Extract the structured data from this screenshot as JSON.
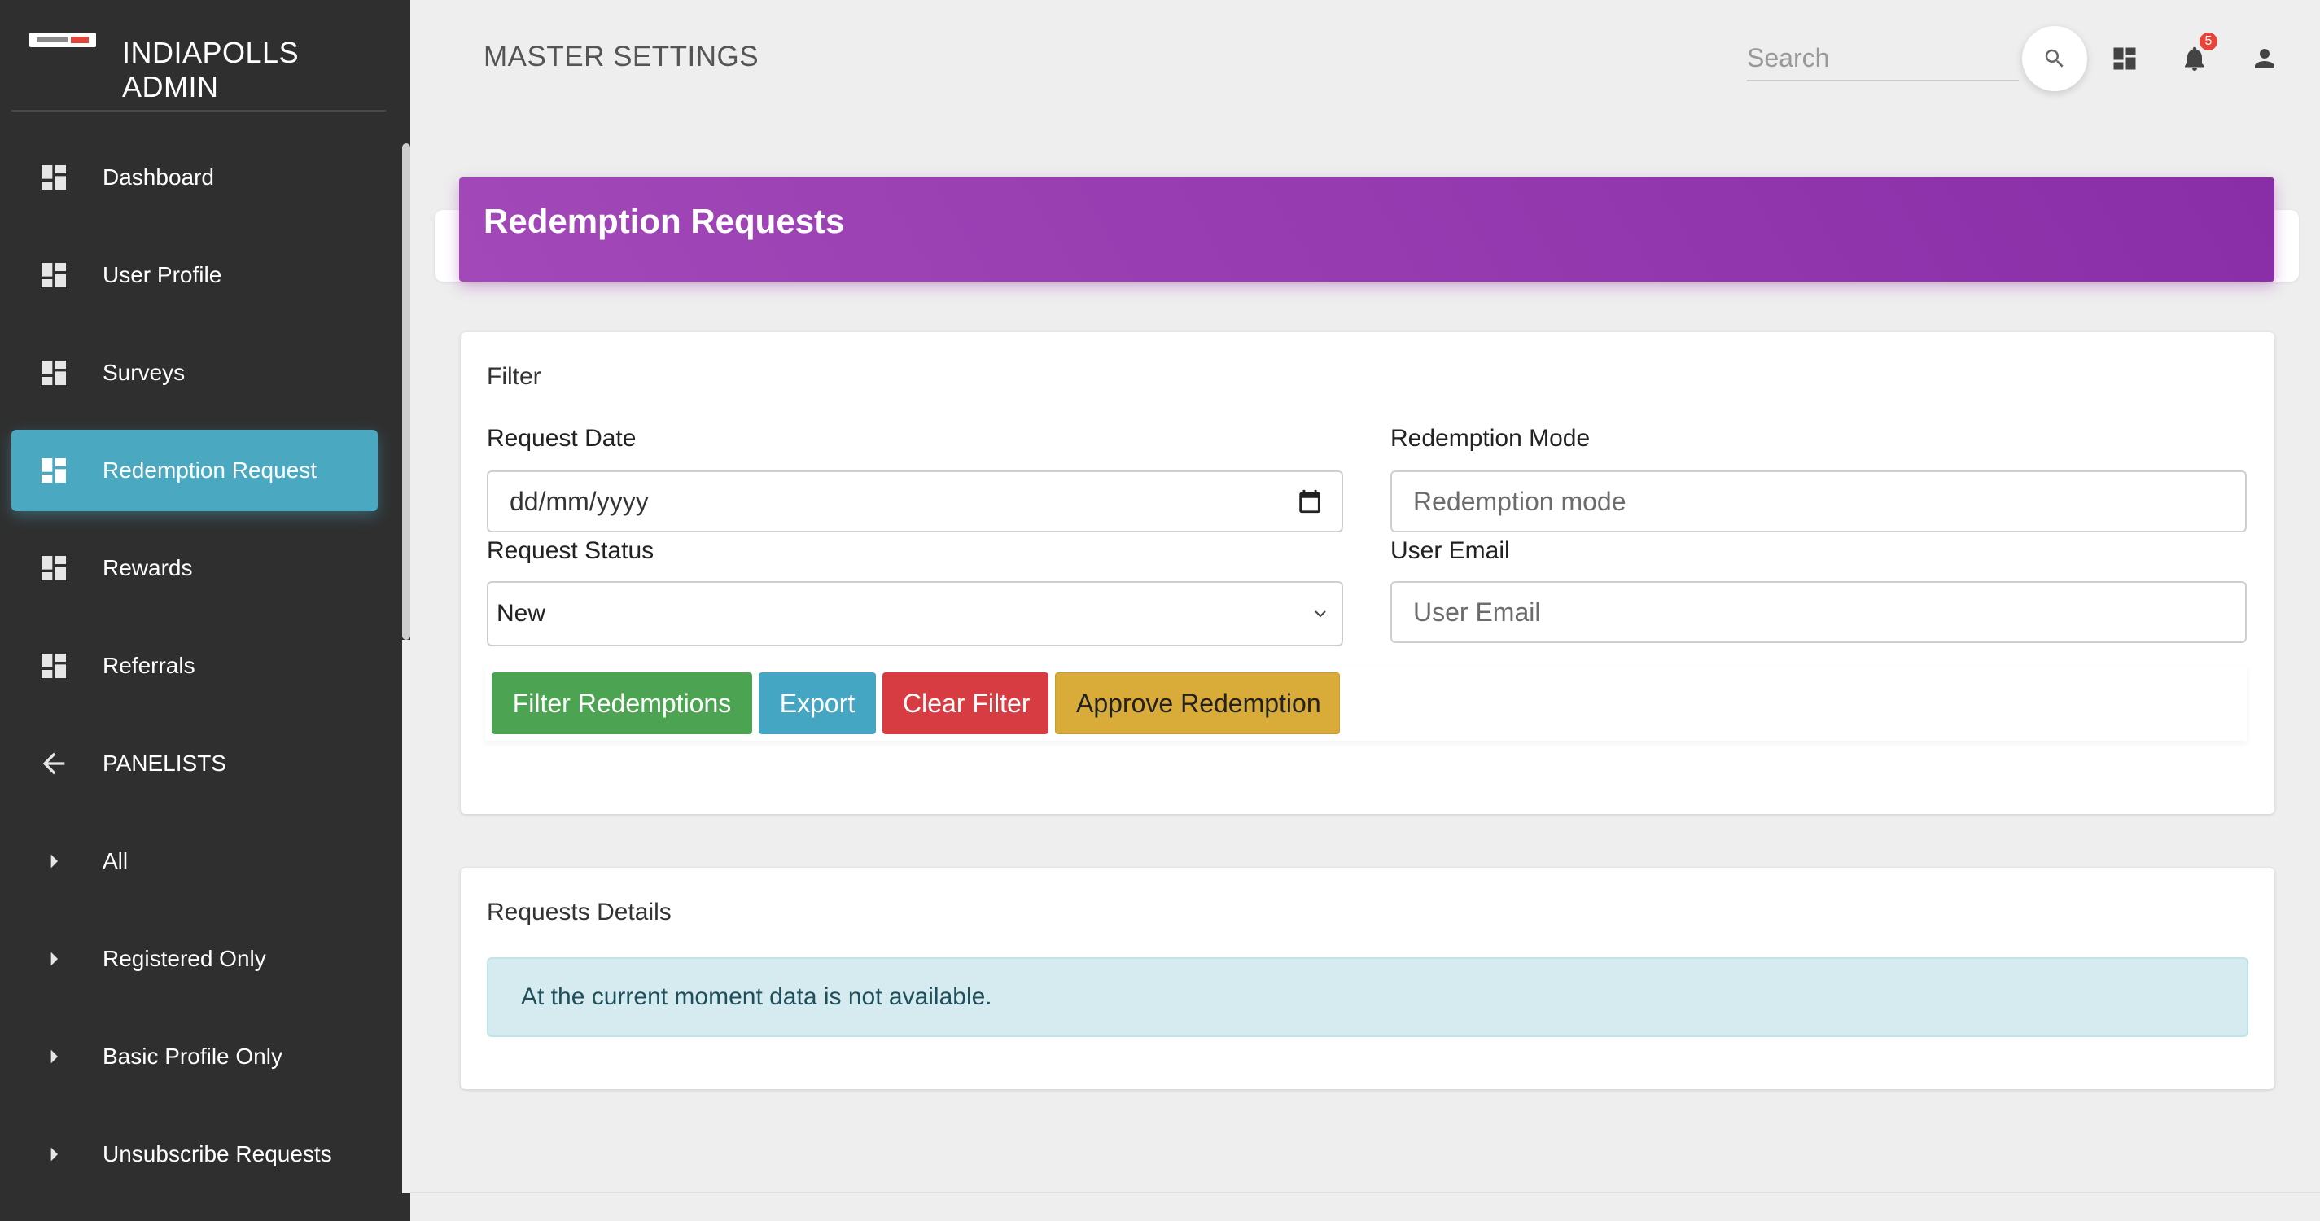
{
  "app": {
    "title": "INDIAPOLLS ADMIN",
    "logo_icon": "indiapolls-logo"
  },
  "sidebar": {
    "items": [
      {
        "label": "Dashboard",
        "icon": "dashboard-icon",
        "active": false
      },
      {
        "label": "User Profile",
        "icon": "dashboard-icon",
        "active": false
      },
      {
        "label": "Surveys",
        "icon": "dashboard-icon",
        "active": false
      },
      {
        "label": "Redemption Request",
        "icon": "dashboard-icon",
        "active": true
      },
      {
        "label": "Rewards",
        "icon": "dashboard-icon",
        "active": false
      },
      {
        "label": "Referrals",
        "icon": "dashboard-icon",
        "active": false
      },
      {
        "label": "PANELISTS",
        "icon": "arrow-back-icon",
        "active": false
      },
      {
        "label": "All",
        "icon": "caret-right-icon",
        "active": false
      },
      {
        "label": "Registered Only",
        "icon": "caret-right-icon",
        "active": false
      },
      {
        "label": "Basic Profile Only",
        "icon": "caret-right-icon",
        "active": false
      },
      {
        "label": "Unsubscribe Requests",
        "icon": "caret-right-icon",
        "active": false
      }
    ]
  },
  "navbar": {
    "heading": "MASTER SETTINGS",
    "search_placeholder": "Search",
    "notification_count": "5",
    "icons": [
      "search-icon",
      "dashboard-icon",
      "bell-icon",
      "person-icon"
    ]
  },
  "page": {
    "card_title": "Redemption Requests"
  },
  "filter": {
    "title": "Filter",
    "request_date_label": "Request Date",
    "request_date_placeholder": "dd/mm/yyyy",
    "redemption_mode_label": "Redemption Mode",
    "redemption_mode_placeholder": "Redemption mode",
    "request_status_label": "Request Status",
    "request_status_value": "New",
    "user_email_label": "User Email",
    "user_email_placeholder": "User Email",
    "buttons": {
      "filter": "Filter Redemptions",
      "export": "Export",
      "clear": "Clear Filter",
      "approve": "Approve Redemption"
    }
  },
  "details": {
    "title": "Requests Details",
    "empty_message": "At the current moment data is not available."
  },
  "colors": {
    "sidebar_bg": "#2f2f2f",
    "active_item": "#4aa8c0",
    "header_gradient_start": "#a248b8",
    "header_gradient_end": "#8a2ea8",
    "btn_green": "#4ca452",
    "btn_cyan": "#45a6c3",
    "btn_red": "#d73c43",
    "btn_yellow": "#d9ab38",
    "badge": "#e9443a"
  }
}
